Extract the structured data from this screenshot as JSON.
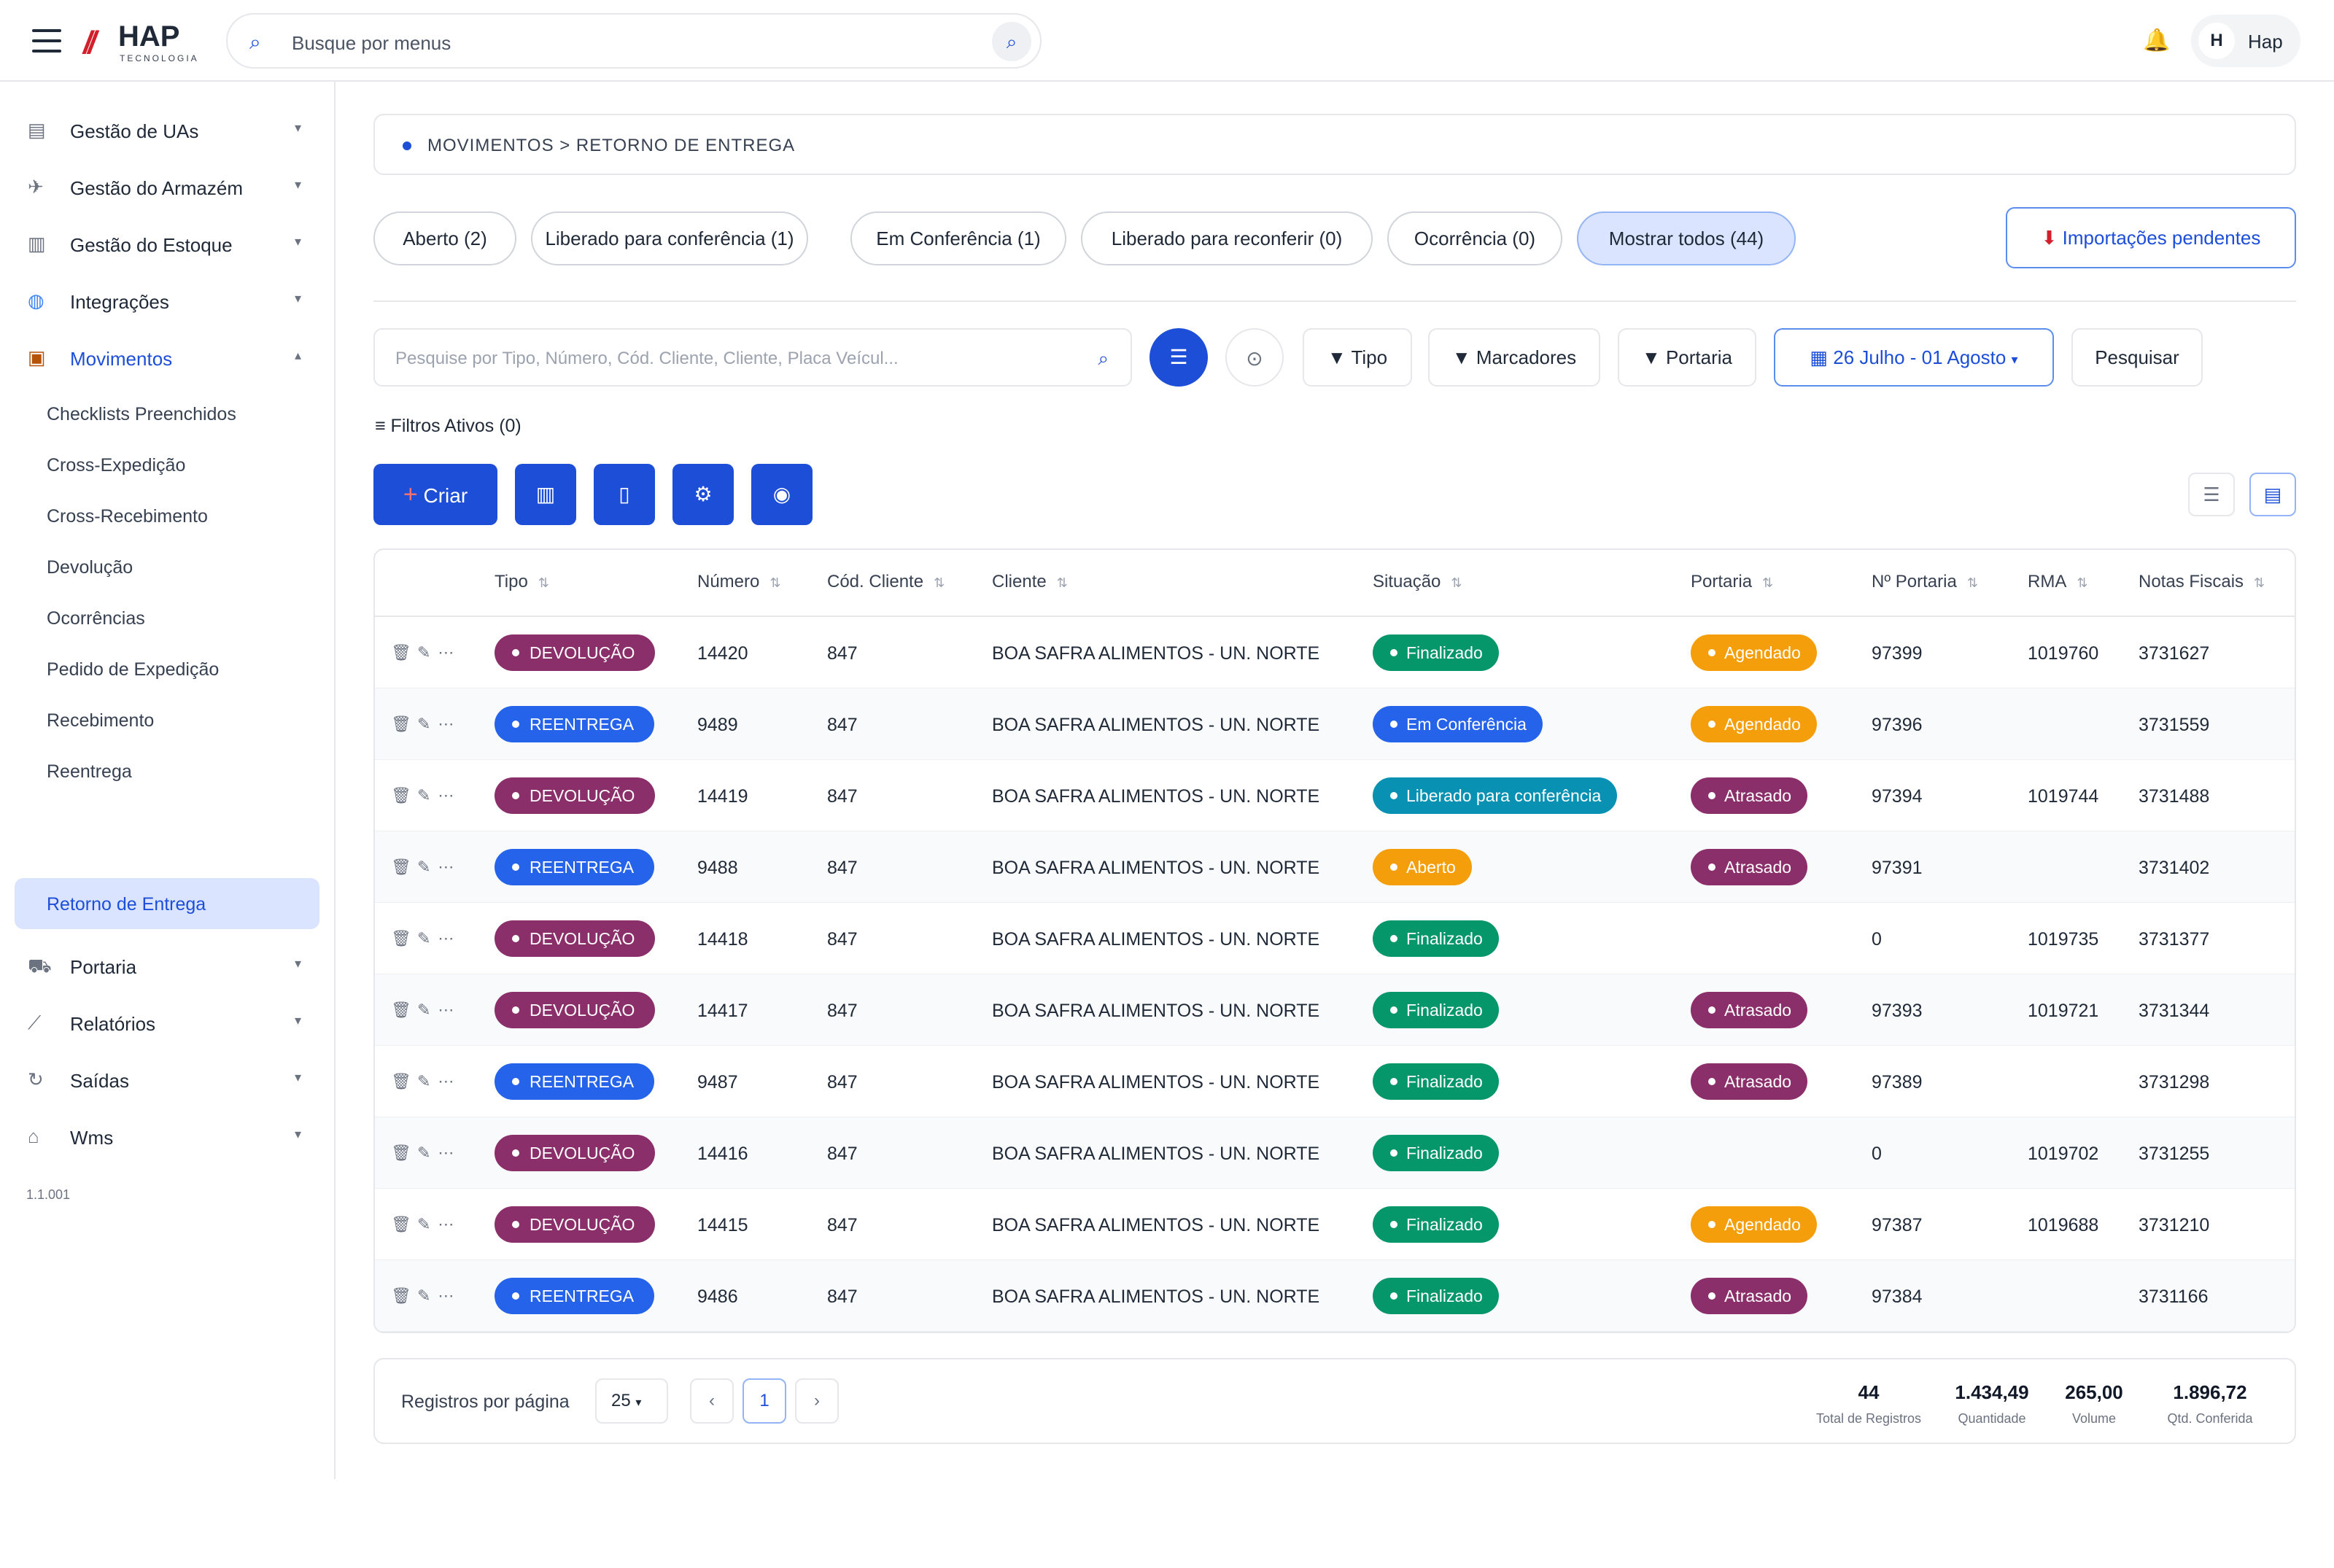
{
  "header": {
    "logo_name": "HAP",
    "logo_sub": "TECNOLOGIA",
    "search_placeholder": "Busque por menus",
    "user_initial": "H",
    "user_name": "Hap"
  },
  "sidebar": {
    "items": [
      {
        "label": "Gestão de UAs",
        "icon": "building-icon"
      },
      {
        "label": "Gestão do Armazém",
        "icon": "world-icon"
      },
      {
        "label": "Gestão do Estoque",
        "icon": "chart-icon"
      },
      {
        "label": "Integrações",
        "icon": "globe-icon"
      },
      {
        "label": "Movimentos",
        "icon": "box-icon"
      }
    ],
    "subitems": [
      "Checklists Preenchidos",
      "Cross-Expedição",
      "Cross-Recebimento",
      "Devolução",
      "Ocorrências",
      "Pedido de Expedição",
      "Recebimento",
      "Reentrega",
      "Retorno de Entrega"
    ],
    "items2": [
      {
        "label": "Portaria",
        "icon": "truck-icon"
      },
      {
        "label": "Relatórios",
        "icon": "line-chart-icon"
      },
      {
        "label": "Saídas",
        "icon": "exit-icon"
      },
      {
        "label": "Wms",
        "icon": "house-icon"
      }
    ],
    "version": "1.1.001"
  },
  "breadcrumb": "MOVIMENTOS > RETORNO DE ENTREGA",
  "status_tabs": [
    "Aberto (2)",
    "Liberado para conferência (1)",
    "Em Conferência (1)",
    "Liberado para reconferir (0)",
    "Ocorrência (0)",
    "Mostrar todos (44)"
  ],
  "import_label": "Importações pendentes",
  "filters": {
    "search_placeholder": "Pesquise por Tipo, Número, Cód. Cliente, Cliente, Placa Veícul...",
    "tipo": "Tipo",
    "marcadores": "Marcadores",
    "portaria": "Portaria",
    "date_range": "26 Julho - 01 Agosto",
    "search_button": "Pesquisar",
    "active": "Filtros Ativos (0)"
  },
  "create_label": "Criar",
  "table": {
    "headers": [
      "Tipo",
      "Número",
      "Cód. Cliente",
      "Cliente",
      "Situação",
      "Portaria",
      "Nº Portaria",
      "RMA",
      "Notas Fiscais"
    ],
    "rows": [
      {
        "tipo": "DEVOLUÇÃO",
        "numero": "14420",
        "cod": "847",
        "cliente": "BOA SAFRA ALIMENTOS - UN. NORTE",
        "situacao": "Finalizado",
        "portaria": "Agendado",
        "nport": "97399",
        "rma": "1019760",
        "nf": "3731627"
      },
      {
        "tipo": "REENTREGA",
        "numero": "9489",
        "cod": "847",
        "cliente": "BOA SAFRA ALIMENTOS - UN. NORTE",
        "situacao": "Em Conferência",
        "portaria": "Agendado",
        "nport": "97396",
        "rma": "",
        "nf": "3731559"
      },
      {
        "tipo": "DEVOLUÇÃO",
        "numero": "14419",
        "cod": "847",
        "cliente": "BOA SAFRA ALIMENTOS - UN. NORTE",
        "situacao": "Liberado para conferência",
        "portaria": "Atrasado",
        "nport": "97394",
        "rma": "1019744",
        "nf": "3731488"
      },
      {
        "tipo": "REENTREGA",
        "numero": "9488",
        "cod": "847",
        "cliente": "BOA SAFRA ALIMENTOS - UN. NORTE",
        "situacao": "Aberto",
        "portaria": "Atrasado",
        "nport": "97391",
        "rma": "",
        "nf": "3731402"
      },
      {
        "tipo": "DEVOLUÇÃO",
        "numero": "14418",
        "cod": "847",
        "cliente": "BOA SAFRA ALIMENTOS - UN. NORTE",
        "situacao": "Finalizado",
        "portaria": "",
        "nport": "0",
        "rma": "1019735",
        "nf": "3731377"
      },
      {
        "tipo": "DEVOLUÇÃO",
        "numero": "14417",
        "cod": "847",
        "cliente": "BOA SAFRA ALIMENTOS - UN. NORTE",
        "situacao": "Finalizado",
        "portaria": "Atrasado",
        "nport": "97393",
        "rma": "1019721",
        "nf": "3731344"
      },
      {
        "tipo": "REENTREGA",
        "numero": "9487",
        "cod": "847",
        "cliente": "BOA SAFRA ALIMENTOS - UN. NORTE",
        "situacao": "Finalizado",
        "portaria": "Atrasado",
        "nport": "97389",
        "rma": "",
        "nf": "3731298"
      },
      {
        "tipo": "DEVOLUÇÃO",
        "numero": "14416",
        "cod": "847",
        "cliente": "BOA SAFRA ALIMENTOS - UN. NORTE",
        "situacao": "Finalizado",
        "portaria": "",
        "nport": "0",
        "rma": "1019702",
        "nf": "3731255"
      },
      {
        "tipo": "DEVOLUÇÃO",
        "numero": "14415",
        "cod": "847",
        "cliente": "BOA SAFRA ALIMENTOS - UN. NORTE",
        "situacao": "Finalizado",
        "portaria": "Agendado",
        "nport": "97387",
        "rma": "1019688",
        "nf": "3731210"
      },
      {
        "tipo": "REENTREGA",
        "numero": "9486",
        "cod": "847",
        "cliente": "BOA SAFRA ALIMENTOS - UN. NORTE",
        "situacao": "Finalizado",
        "portaria": "Atrasado",
        "nport": "97384",
        "rma": "",
        "nf": "3731166"
      }
    ]
  },
  "colors": {
    "DEVOLUÇÃO": "#8b2f6b",
    "REENTREGA": "#2563eb",
    "Finalizado": "#059669",
    "Em Conferência": "#2563eb",
    "Liberado para conferência": "#0891b2",
    "Aberto": "#f59e0b",
    "Agendado": "#f59e0b",
    "Atrasado": "#8b2f6b"
  },
  "footer": {
    "per_page_label": "Registros por página",
    "per_page": "25",
    "page": "1",
    "prev": "‹",
    "next": "›",
    "stats": [
      {
        "value": "44",
        "label": "Total de Registros"
      },
      {
        "value": "1.434,49",
        "label": "Quantidade"
      },
      {
        "value": "265,00",
        "label": "Volume"
      },
      {
        "value": "1.896,72",
        "label": "Qtd. Conferida"
      }
    ]
  }
}
